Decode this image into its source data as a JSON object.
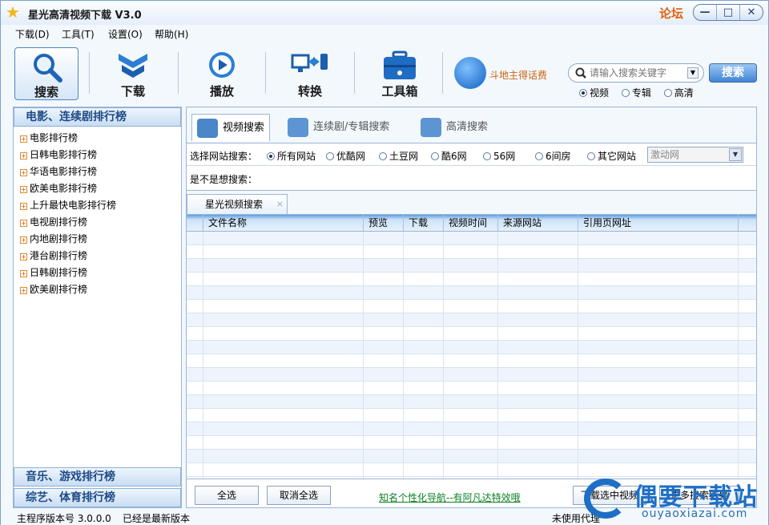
{
  "app": {
    "title": "星光高清视频下载 V3.0",
    "forum": "论坛"
  },
  "window": {
    "min": "—",
    "max": "□",
    "close": "✕"
  },
  "menu": [
    "下载(D)",
    "工具(T)",
    "设置(O)",
    "帮助(H)"
  ],
  "toolbar": {
    "items": [
      {
        "label": "搜索"
      },
      {
        "label": "下载"
      },
      {
        "label": "播放"
      },
      {
        "label": "转换"
      },
      {
        "label": "工具箱"
      }
    ]
  },
  "promo": "斗地主得话费",
  "search": {
    "placeholder": "请输入搜索关键字",
    "button": "搜索",
    "modes": [
      "视频",
      "专辑",
      "高清"
    ]
  },
  "sidebar": {
    "top_header": "电影、连续剧排行榜",
    "items": [
      "电影排行榜",
      "日韩电影排行榜",
      "华语电影排行榜",
      "欧美电影排行榜",
      "上升最快电影排行榜",
      "电视剧排行榜",
      "内地剧排行榜",
      "港台剧排行榜",
      "日韩剧排行榜",
      "欧美剧排行榜"
    ],
    "music_header": "音乐、游戏排行榜",
    "variety_header": "综艺、体育排行榜"
  },
  "tabs": [
    "视频搜索",
    "连续剧/专辑搜索",
    "高清搜索"
  ],
  "filter": {
    "label": "选择网站搜索：",
    "options": [
      "所有网站",
      "优酷网",
      "土豆网",
      "酷6网",
      "56网",
      "6间房",
      "其它网站"
    ],
    "select_value": "激动网"
  },
  "suggest": "是不是想搜索：",
  "result_tab": {
    "label": "星光视频搜索",
    "close": "×"
  },
  "columns": [
    "文件名称",
    "预览",
    "下载",
    "视频时间",
    "来源网站",
    "引用页网址"
  ],
  "bottom": {
    "select_all": "全选",
    "deselect_all": "取消全选",
    "link": "知名个性化导航--有阿凡达特效哦",
    "download_selected": "下载选中视频",
    "more": "更多搜索结果"
  },
  "status": {
    "version": "主程序版本号 3.0.0.0",
    "latest": "已经是最新版本",
    "proxy": "未使用代理"
  },
  "watermark": {
    "brand": "偶要下载站",
    "url": "ouyaoxiazai.com"
  }
}
